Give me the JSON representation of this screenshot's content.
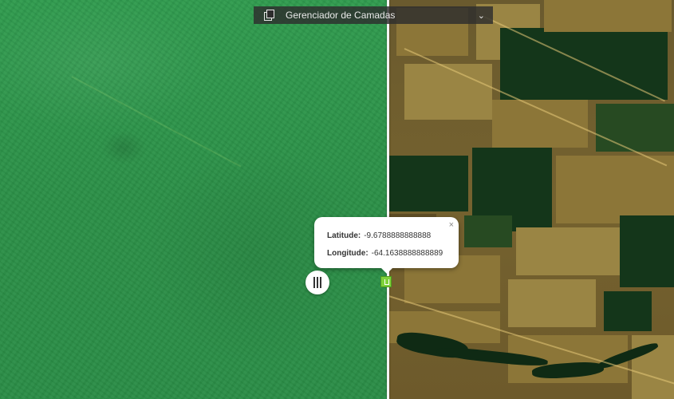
{
  "layer_manager": {
    "label": "Gerenciador de Camadas",
    "icon": "layers-icon",
    "toggle_icon": "chevron-down-icon"
  },
  "swipe_handle": {
    "icon": "drag-handle-icon"
  },
  "marker": {
    "icon": "location-marker-icon",
    "color": "#7fd23a"
  },
  "popup": {
    "latitude_label": "Latitude:",
    "latitude_value": "-9.6788888888888",
    "longitude_label": "Longitude:",
    "longitude_value": "-64.1638888888889",
    "close_symbol": "×"
  },
  "colors": {
    "forest": "#2f9b4e",
    "cleared_land": "#8c7638",
    "remaining_forest": "#14361a",
    "divider": "#f4f4f4"
  }
}
